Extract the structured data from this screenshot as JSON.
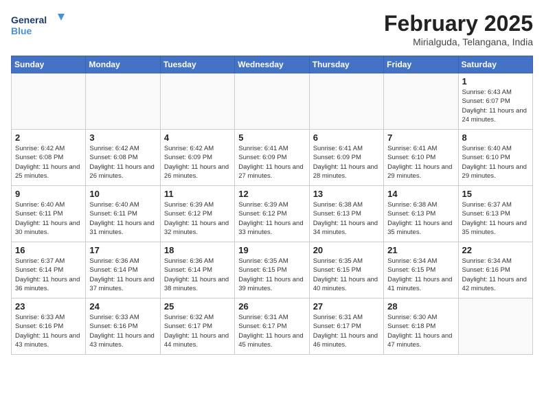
{
  "header": {
    "logo_line1": "General",
    "logo_line2": "Blue",
    "month_year": "February 2025",
    "location": "Mirialguda, Telangana, India"
  },
  "weekdays": [
    "Sunday",
    "Monday",
    "Tuesday",
    "Wednesday",
    "Thursday",
    "Friday",
    "Saturday"
  ],
  "weeks": [
    [
      {
        "day": "",
        "info": ""
      },
      {
        "day": "",
        "info": ""
      },
      {
        "day": "",
        "info": ""
      },
      {
        "day": "",
        "info": ""
      },
      {
        "day": "",
        "info": ""
      },
      {
        "day": "",
        "info": ""
      },
      {
        "day": "1",
        "info": "Sunrise: 6:43 AM\nSunset: 6:07 PM\nDaylight: 11 hours and 24 minutes."
      }
    ],
    [
      {
        "day": "2",
        "info": "Sunrise: 6:42 AM\nSunset: 6:08 PM\nDaylight: 11 hours and 25 minutes."
      },
      {
        "day": "3",
        "info": "Sunrise: 6:42 AM\nSunset: 6:08 PM\nDaylight: 11 hours and 26 minutes."
      },
      {
        "day": "4",
        "info": "Sunrise: 6:42 AM\nSunset: 6:09 PM\nDaylight: 11 hours and 26 minutes."
      },
      {
        "day": "5",
        "info": "Sunrise: 6:41 AM\nSunset: 6:09 PM\nDaylight: 11 hours and 27 minutes."
      },
      {
        "day": "6",
        "info": "Sunrise: 6:41 AM\nSunset: 6:09 PM\nDaylight: 11 hours and 28 minutes."
      },
      {
        "day": "7",
        "info": "Sunrise: 6:41 AM\nSunset: 6:10 PM\nDaylight: 11 hours and 29 minutes."
      },
      {
        "day": "8",
        "info": "Sunrise: 6:40 AM\nSunset: 6:10 PM\nDaylight: 11 hours and 29 minutes."
      }
    ],
    [
      {
        "day": "9",
        "info": "Sunrise: 6:40 AM\nSunset: 6:11 PM\nDaylight: 11 hours and 30 minutes."
      },
      {
        "day": "10",
        "info": "Sunrise: 6:40 AM\nSunset: 6:11 PM\nDaylight: 11 hours and 31 minutes."
      },
      {
        "day": "11",
        "info": "Sunrise: 6:39 AM\nSunset: 6:12 PM\nDaylight: 11 hours and 32 minutes."
      },
      {
        "day": "12",
        "info": "Sunrise: 6:39 AM\nSunset: 6:12 PM\nDaylight: 11 hours and 33 minutes."
      },
      {
        "day": "13",
        "info": "Sunrise: 6:38 AM\nSunset: 6:13 PM\nDaylight: 11 hours and 34 minutes."
      },
      {
        "day": "14",
        "info": "Sunrise: 6:38 AM\nSunset: 6:13 PM\nDaylight: 11 hours and 35 minutes."
      },
      {
        "day": "15",
        "info": "Sunrise: 6:37 AM\nSunset: 6:13 PM\nDaylight: 11 hours and 35 minutes."
      }
    ],
    [
      {
        "day": "16",
        "info": "Sunrise: 6:37 AM\nSunset: 6:14 PM\nDaylight: 11 hours and 36 minutes."
      },
      {
        "day": "17",
        "info": "Sunrise: 6:36 AM\nSunset: 6:14 PM\nDaylight: 11 hours and 37 minutes."
      },
      {
        "day": "18",
        "info": "Sunrise: 6:36 AM\nSunset: 6:14 PM\nDaylight: 11 hours and 38 minutes."
      },
      {
        "day": "19",
        "info": "Sunrise: 6:35 AM\nSunset: 6:15 PM\nDaylight: 11 hours and 39 minutes."
      },
      {
        "day": "20",
        "info": "Sunrise: 6:35 AM\nSunset: 6:15 PM\nDaylight: 11 hours and 40 minutes."
      },
      {
        "day": "21",
        "info": "Sunrise: 6:34 AM\nSunset: 6:15 PM\nDaylight: 11 hours and 41 minutes."
      },
      {
        "day": "22",
        "info": "Sunrise: 6:34 AM\nSunset: 6:16 PM\nDaylight: 11 hours and 42 minutes."
      }
    ],
    [
      {
        "day": "23",
        "info": "Sunrise: 6:33 AM\nSunset: 6:16 PM\nDaylight: 11 hours and 43 minutes."
      },
      {
        "day": "24",
        "info": "Sunrise: 6:33 AM\nSunset: 6:16 PM\nDaylight: 11 hours and 43 minutes."
      },
      {
        "day": "25",
        "info": "Sunrise: 6:32 AM\nSunset: 6:17 PM\nDaylight: 11 hours and 44 minutes."
      },
      {
        "day": "26",
        "info": "Sunrise: 6:31 AM\nSunset: 6:17 PM\nDaylight: 11 hours and 45 minutes."
      },
      {
        "day": "27",
        "info": "Sunrise: 6:31 AM\nSunset: 6:17 PM\nDaylight: 11 hours and 46 minutes."
      },
      {
        "day": "28",
        "info": "Sunrise: 6:30 AM\nSunset: 6:18 PM\nDaylight: 11 hours and 47 minutes."
      },
      {
        "day": "",
        "info": ""
      }
    ]
  ]
}
